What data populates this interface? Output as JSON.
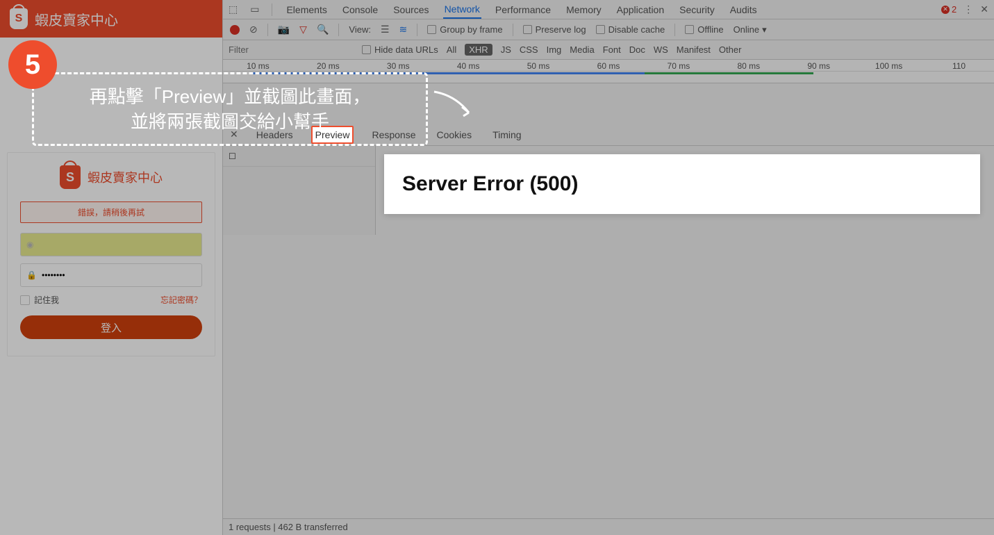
{
  "app": {
    "title": "蝦皮賣家中心",
    "logo_letter": "S"
  },
  "login": {
    "title": "蝦皮賣家中心",
    "error_text": "錯誤，請稍後再試",
    "username_value": "",
    "password_value": "••••••••",
    "remember_label": "記住我",
    "forgot_label": "忘記密碼？",
    "login_button": "登入"
  },
  "devtools": {
    "tabs": [
      "Elements",
      "Console",
      "Sources",
      "Network",
      "Performance",
      "Memory",
      "Application",
      "Security",
      "Audits"
    ],
    "active_tab": "Network",
    "error_count": "2",
    "toolbar": {
      "view_label": "View:",
      "group_by_frame": "Group by frame",
      "preserve_log": "Preserve log",
      "disable_cache": "Disable cache",
      "offline": "Offline",
      "online": "Online"
    },
    "filter": {
      "placeholder": "Filter",
      "hide_data_urls": "Hide data URLs",
      "options": [
        "All",
        "XHR",
        "JS",
        "CSS",
        "Img",
        "Media",
        "Font",
        "Doc",
        "WS",
        "Manifest",
        "Other"
      ],
      "active_option": "XHR"
    },
    "timeline_ticks": [
      "10 ms",
      "20 ms",
      "30 ms",
      "40 ms",
      "50 ms",
      "60 ms",
      "70 ms",
      "80 ms",
      "90 ms",
      "100 ms",
      "110"
    ],
    "detail_tabs": [
      "Headers",
      "Preview",
      "Response",
      "Cookies",
      "Timing"
    ],
    "active_detail_tab": "Preview",
    "preview_content": "Server Error (500)",
    "status_bar": "1 requests | 462 B transferred"
  },
  "annotation": {
    "step_number": "5",
    "line1": "再點擊「Preview」並截圖此畫面，",
    "line2": "並將兩張截圖交給小幫手"
  }
}
